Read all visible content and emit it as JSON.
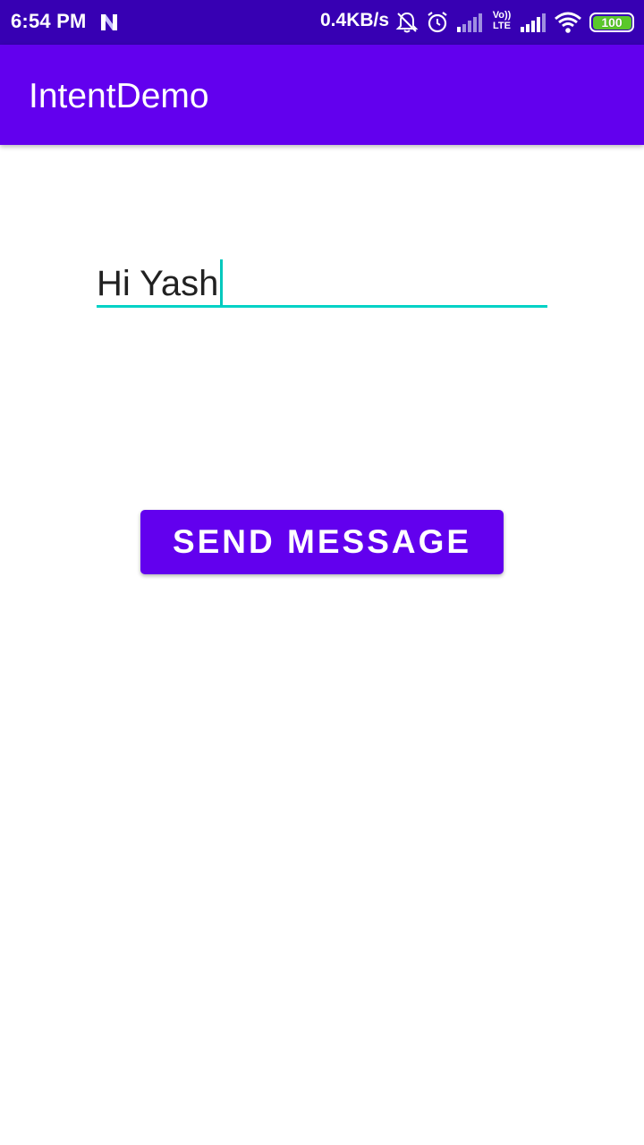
{
  "status_bar": {
    "time": "6:54 PM",
    "network_speed": "0.4KB/s",
    "volte_label_top": "Vo))",
    "volte_label_bottom": "LTE",
    "battery_level": "100",
    "icons": [
      "notification-n-icon",
      "bell-off-icon",
      "alarm-icon",
      "signal-icon",
      "volte-icon",
      "signal-icon",
      "wifi-icon",
      "battery-icon"
    ]
  },
  "app_bar": {
    "title": "IntentDemo"
  },
  "main": {
    "message_input": {
      "value": "Hi Yash"
    },
    "send_button_label": "SEND MESSAGE"
  },
  "colors": {
    "status_bar": "#3700b3",
    "primary": "#6200ee",
    "accent": "#00d2c6",
    "battery": "#5ac82a"
  }
}
